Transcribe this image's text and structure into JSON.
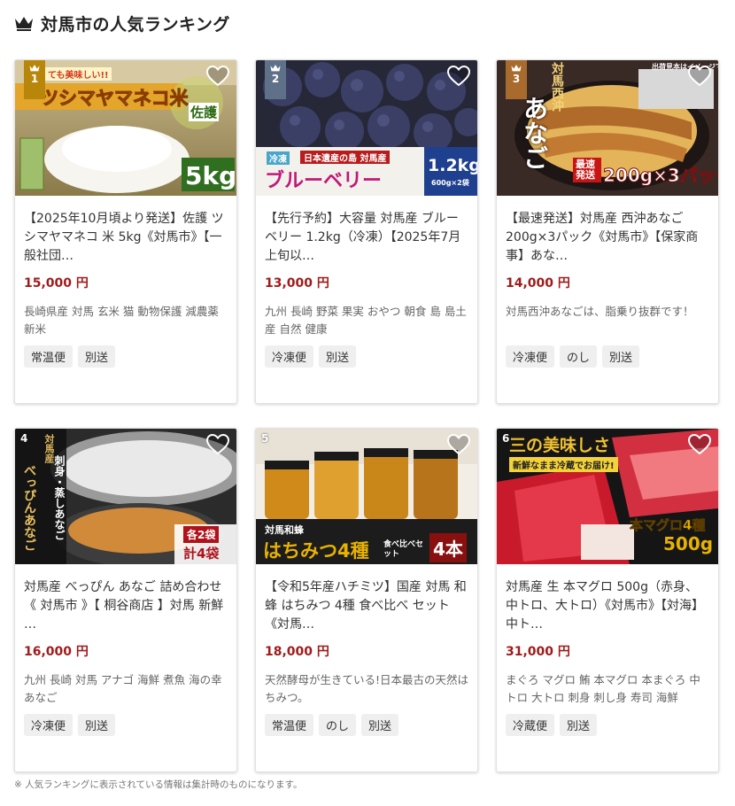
{
  "header": {
    "title": "対馬市の人気ランキング"
  },
  "cards": [
    {
      "rank": "1",
      "title": "【2025年10月頃より発送】佐護 ツシマヤマネコ 米 5kg《対馬市》【一般社団…",
      "price": "15,000 円",
      "tags": "長崎県産 対馬 玄米 猫 動物保護 減農薬 新米",
      "chips": [
        "常温便",
        "別送"
      ],
      "image_text": {
        "a": "ても美味しい!!",
        "b": "ツシマヤマネコ米",
        "c": "佐護",
        "d": "5kg"
      }
    },
    {
      "rank": "2",
      "title": "【先行予約】大容量 対馬産 ブルーベリー 1.2kg（冷凍）【2025年7月上旬以…",
      "price": "13,000 円",
      "tags": "九州 長崎 野菜 果実 おやつ 朝食 島 島土産 自然 健康",
      "chips": [
        "冷凍便",
        "別送"
      ],
      "image_text": {
        "a": "冷凍",
        "b": "日本遺産の島 対馬産",
        "c": "ブルーベリー",
        "d": "1.2kg",
        "e": "600g×2袋"
      }
    },
    {
      "rank": "3",
      "title": "【最速発送】対馬産 西沖あなご 200g×3パック《対馬市》【保家商事】あな…",
      "price": "14,000 円",
      "tags": "対馬西沖あなごは、脂乗り抜群です！",
      "chips": [
        "冷凍便",
        "のし",
        "別送"
      ],
      "image_text": {
        "a": "対馬西沖",
        "b": "あなご",
        "c": "最速発送",
        "d": "200g×3パック",
        "e": "出荷見本はイメージです"
      }
    },
    {
      "rank": "4",
      "title": "対馬産 べっぴん あなご 詰め合わせ《 対馬市 》【 桐谷商店 】対馬 新鮮 …",
      "price": "16,000 円",
      "tags": "九州 長崎 対馬 アナゴ 海鮮 煮魚 海の幸 あなご",
      "chips": [
        "冷凍便",
        "別送"
      ],
      "image_text": {
        "a": "対馬産",
        "b": "刺身・蒸しあなご",
        "c": "べっぴんあなご",
        "d": "各2袋",
        "e": "計4袋"
      }
    },
    {
      "rank": "5",
      "title": "【令和5年産ハチミツ】国産 対馬 和蜂 はちみつ 4種 食べ比べ セット《対馬…",
      "price": "18,000 円",
      "tags": "天然酵母が生きている!日本最古の天然はちみつ。",
      "chips": [
        "常温便",
        "のし",
        "別送"
      ],
      "image_text": {
        "a": "対馬和蜂",
        "b": "はちみつ4種",
        "c": "食べ比べセット",
        "d": "4本"
      }
    },
    {
      "rank": "6",
      "title": "対馬産 生 本マグロ 500g（赤身、中トロ、大トロ）《対馬市》【対海】中ト…",
      "price": "31,000 円",
      "tags": "まぐろ マグロ 鮪 本マグロ 本まぐろ 中トロ 大トロ 刺身 刺し身 寿司 海鮮",
      "chips": [
        "冷蔵便",
        "別送"
      ],
      "image_text": {
        "a": "三の美味しさ",
        "b": "新鮮なまま冷蔵でお届け!",
        "c": "本マグロ4種",
        "d": "500g"
      }
    }
  ],
  "footer": {
    "note": "※ 人気ランキングに表示されている情報は集計時のものになります。"
  },
  "colors": {
    "price": "#a01b1b",
    "gold_badge": "#b8860b",
    "chip_bg": "#efefef"
  }
}
